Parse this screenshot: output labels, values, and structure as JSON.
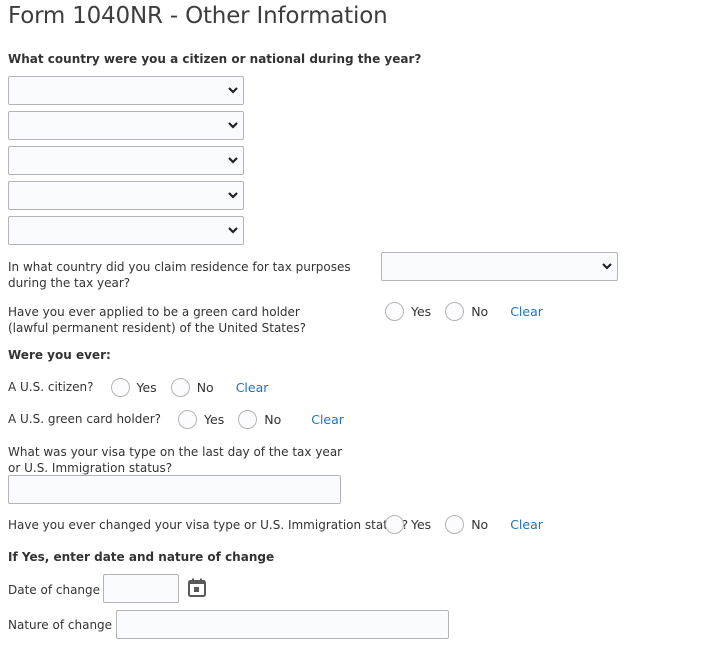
{
  "page": {
    "title": "Form 1040NR - Other Information"
  },
  "citizenship": {
    "question": "What country were you a citizen or national during the year?",
    "selects": [
      {
        "value": ""
      },
      {
        "value": ""
      },
      {
        "value": ""
      },
      {
        "value": ""
      },
      {
        "value": ""
      }
    ]
  },
  "residence": {
    "question": "In what country did you claim residence for tax purposes during the tax year?",
    "select_value": ""
  },
  "green_card_applied": {
    "question": "Have you ever applied to be a green card holder (lawful permanent resident) of the United States?",
    "yes_label": "Yes",
    "no_label": "No",
    "clear_label": "Clear"
  },
  "were_you_ever": {
    "heading": "Were you ever:",
    "us_citizen": {
      "question": "A U.S. citizen?",
      "yes_label": "Yes",
      "no_label": "No",
      "clear_label": "Clear"
    },
    "green_card_holder": {
      "question": "A U.S. green card holder?",
      "yes_label": "Yes",
      "no_label": "No",
      "clear_label": "Clear"
    }
  },
  "visa_type": {
    "question": "What was your visa type on the last day of the tax year or U.S. Immigration status?",
    "value": ""
  },
  "visa_changed": {
    "question": "Have you ever changed your visa type or U.S. Immigration status?",
    "yes_label": "Yes",
    "no_label": "No",
    "clear_label": "Clear"
  },
  "change_details": {
    "heading": "If Yes, enter date and nature of change",
    "date_label": "Date of change",
    "date_value": "",
    "nature_label": "Nature of change",
    "nature_value": ""
  },
  "icons": {
    "dropdown": "chevron-down-icon",
    "date_picker": "calendar-icon"
  }
}
